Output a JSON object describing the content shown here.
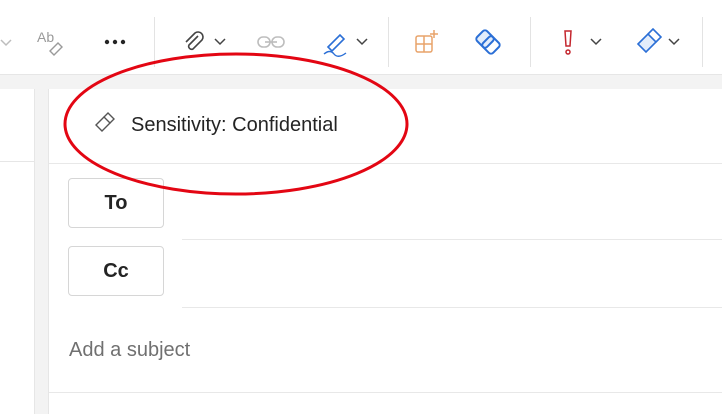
{
  "toolbar": {
    "items": [
      {
        "name": "spelling-icon"
      },
      {
        "name": "more-options-icon",
        "label": "..."
      },
      {
        "name": "attach-file-icon"
      },
      {
        "name": "insert-link-icon"
      },
      {
        "name": "signature-icon"
      },
      {
        "name": "apps-add-icon"
      },
      {
        "name": "loop-icon"
      },
      {
        "name": "importance-icon"
      },
      {
        "name": "sensitivity-icon"
      }
    ],
    "colors": {
      "icon_gray": "#9a9a9a",
      "icon_dark": "#242424",
      "brand_blue": "#2b6fd6",
      "importance_red": "#c4262e",
      "apps_orange": "#e8a36a"
    }
  },
  "compose": {
    "sensitivity_label": "Sensitivity: Confidential",
    "to_label": "To",
    "cc_label": "Cc",
    "subject_placeholder": "Add a subject"
  },
  "annotation": {
    "color": "#e30613"
  }
}
